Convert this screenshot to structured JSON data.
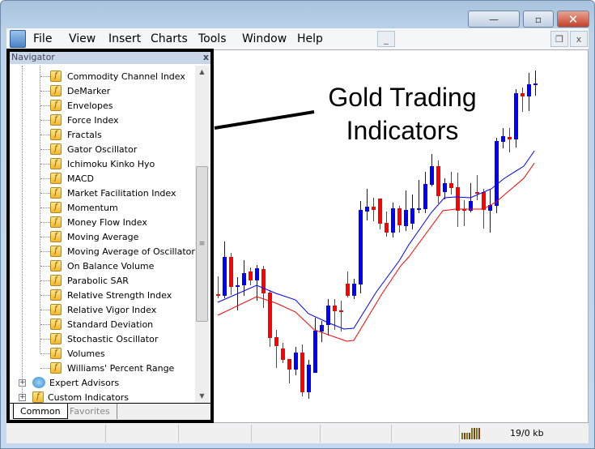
{
  "window": {
    "controls": {
      "minimize": "—",
      "maximize": "▫",
      "close": "✕"
    }
  },
  "menu": [
    "File",
    "View",
    "Insert",
    "Charts",
    "Tools",
    "Window",
    "Help"
  ],
  "mdi": {
    "minimize": "_",
    "restore": "❐",
    "close": "x"
  },
  "navigator": {
    "title": "Navigator",
    "close": "x",
    "items": [
      "Commodity Channel Index",
      "DeMarker",
      "Envelopes",
      "Force Index",
      "Fractals",
      "Gator Oscillator",
      "Ichimoku Kinko Hyo",
      "MACD",
      "Market Facilitation Index",
      "Momentum",
      "Money Flow Index",
      "Moving Average",
      "Moving Average of Oscillator",
      "On Balance Volume",
      "Parabolic SAR",
      "Relative Strength Index",
      "Relative Vigor Index",
      "Standard Deviation",
      "Stochastic Oscillator",
      "Volumes",
      "Williams' Percent Range"
    ],
    "groups": [
      {
        "label": "Expert Advisors",
        "icon": "expert-advisor-icon"
      },
      {
        "label": "Custom Indicators",
        "icon": "custom-indicator-icon"
      }
    ],
    "tabs": [
      "Common",
      "Favorites"
    ],
    "active_tab": "Common"
  },
  "annotation": {
    "line1": "Gold Trading",
    "line2": "Indicators"
  },
  "status": {
    "traffic": "19/0 kb"
  },
  "colors": {
    "bull": "#0000ff",
    "bear": "#ff0000",
    "ma_fast": "#0000ff",
    "ma_slow": "#ff0000"
  },
  "chart_data": {
    "type": "candlestick",
    "candles": [
      [
        1137,
        1159,
        1132,
        1135
      ],
      [
        1135,
        1202,
        1132,
        1183
      ],
      [
        1183,
        1188,
        1136,
        1146
      ],
      [
        1146,
        1158,
        1117,
        1148
      ],
      [
        1148,
        1179,
        1135,
        1163
      ],
      [
        1165,
        1170,
        1148,
        1154
      ],
      [
        1154,
        1173,
        1129,
        1169
      ],
      [
        1168,
        1172,
        1120,
        1138
      ],
      [
        1139,
        1142,
        1072,
        1083
      ],
      [
        1084,
        1093,
        1046,
        1073
      ],
      [
        1070,
        1077,
        1052,
        1056
      ],
      [
        1057,
        1057,
        1027,
        1044
      ],
      [
        1044,
        1072,
        1037,
        1065
      ],
      [
        1065,
        1075,
        1011,
        1016
      ],
      [
        1016,
        1056,
        1008,
        1050
      ],
      [
        1040,
        1108,
        1040,
        1092
      ],
      [
        1091,
        1104,
        1078,
        1099
      ],
      [
        1099,
        1131,
        1086,
        1123
      ],
      [
        1123,
        1131,
        1093,
        1116
      ],
      [
        1117,
        1129,
        1091,
        1115
      ],
      [
        1150,
        1165,
        1133,
        1135
      ],
      [
        1135,
        1156,
        1131,
        1150
      ],
      [
        1149,
        1252,
        1138,
        1241
      ],
      [
        1239,
        1267,
        1228,
        1245
      ],
      [
        1245,
        1256,
        1227,
        1241
      ],
      [
        1255,
        1255,
        1217,
        1224
      ],
      [
        1225,
        1239,
        1208,
        1213
      ],
      [
        1213,
        1250,
        1207,
        1243
      ],
      [
        1243,
        1246,
        1213,
        1222
      ],
      [
        1221,
        1265,
        1215,
        1241
      ],
      [
        1224,
        1260,
        1217,
        1243
      ],
      [
        1242,
        1278,
        1237,
        1243
      ],
      [
        1242,
        1288,
        1237,
        1273
      ],
      [
        1272,
        1310,
        1270,
        1295
      ],
      [
        1295,
        1302,
        1249,
        1258
      ],
      [
        1263,
        1280,
        1254,
        1274
      ],
      [
        1274,
        1288,
        1260,
        1268
      ],
      [
        1269,
        1287,
        1220,
        1240
      ],
      [
        1242,
        1253,
        1221,
        1240
      ],
      [
        1240,
        1274,
        1238,
        1252
      ],
      [
        1263,
        1284,
        1253,
        1262
      ],
      [
        1263,
        1267,
        1218,
        1241
      ],
      [
        1240,
        1266,
        1213,
        1247
      ],
      [
        1246,
        1330,
        1237,
        1326
      ],
      [
        1325,
        1342,
        1317,
        1332
      ],
      [
        1331,
        1342,
        1312,
        1328
      ],
      [
        1328,
        1390,
        1318,
        1385
      ],
      [
        1385,
        1392,
        1362,
        1381
      ],
      [
        1381,
        1410,
        1363,
        1396
      ],
      [
        1396,
        1413,
        1382,
        1397
      ]
    ],
    "ma_fast": [
      [
        0,
        1127
      ],
      [
        6,
        1148
      ],
      [
        9,
        1138
      ],
      [
        12,
        1130
      ],
      [
        14,
        1113
      ],
      [
        17,
        1102
      ],
      [
        19.5,
        1094
      ],
      [
        21,
        1095
      ],
      [
        24.5,
        1140
      ],
      [
        28,
        1178
      ],
      [
        29.5,
        1198
      ],
      [
        33,
        1238
      ],
      [
        35,
        1256
      ],
      [
        36.75,
        1257
      ],
      [
        39,
        1256
      ],
      [
        42.25,
        1267
      ],
      [
        44.25,
        1280
      ],
      [
        47.25,
        1295
      ],
      [
        48.9,
        1314
      ]
    ],
    "ma_slow": [
      [
        0,
        1111
      ],
      [
        6,
        1134
      ],
      [
        9,
        1126
      ],
      [
        12,
        1115
      ],
      [
        14.9,
        1093
      ],
      [
        19.9,
        1079
      ],
      [
        21,
        1080
      ],
      [
        25.4,
        1138
      ],
      [
        28.25,
        1172
      ],
      [
        29.5,
        1183
      ],
      [
        34.75,
        1240
      ],
      [
        36.75,
        1242
      ],
      [
        41,
        1242
      ],
      [
        43,
        1251
      ],
      [
        44.75,
        1263
      ],
      [
        47.25,
        1280
      ],
      [
        48.9,
        1299
      ]
    ]
  }
}
